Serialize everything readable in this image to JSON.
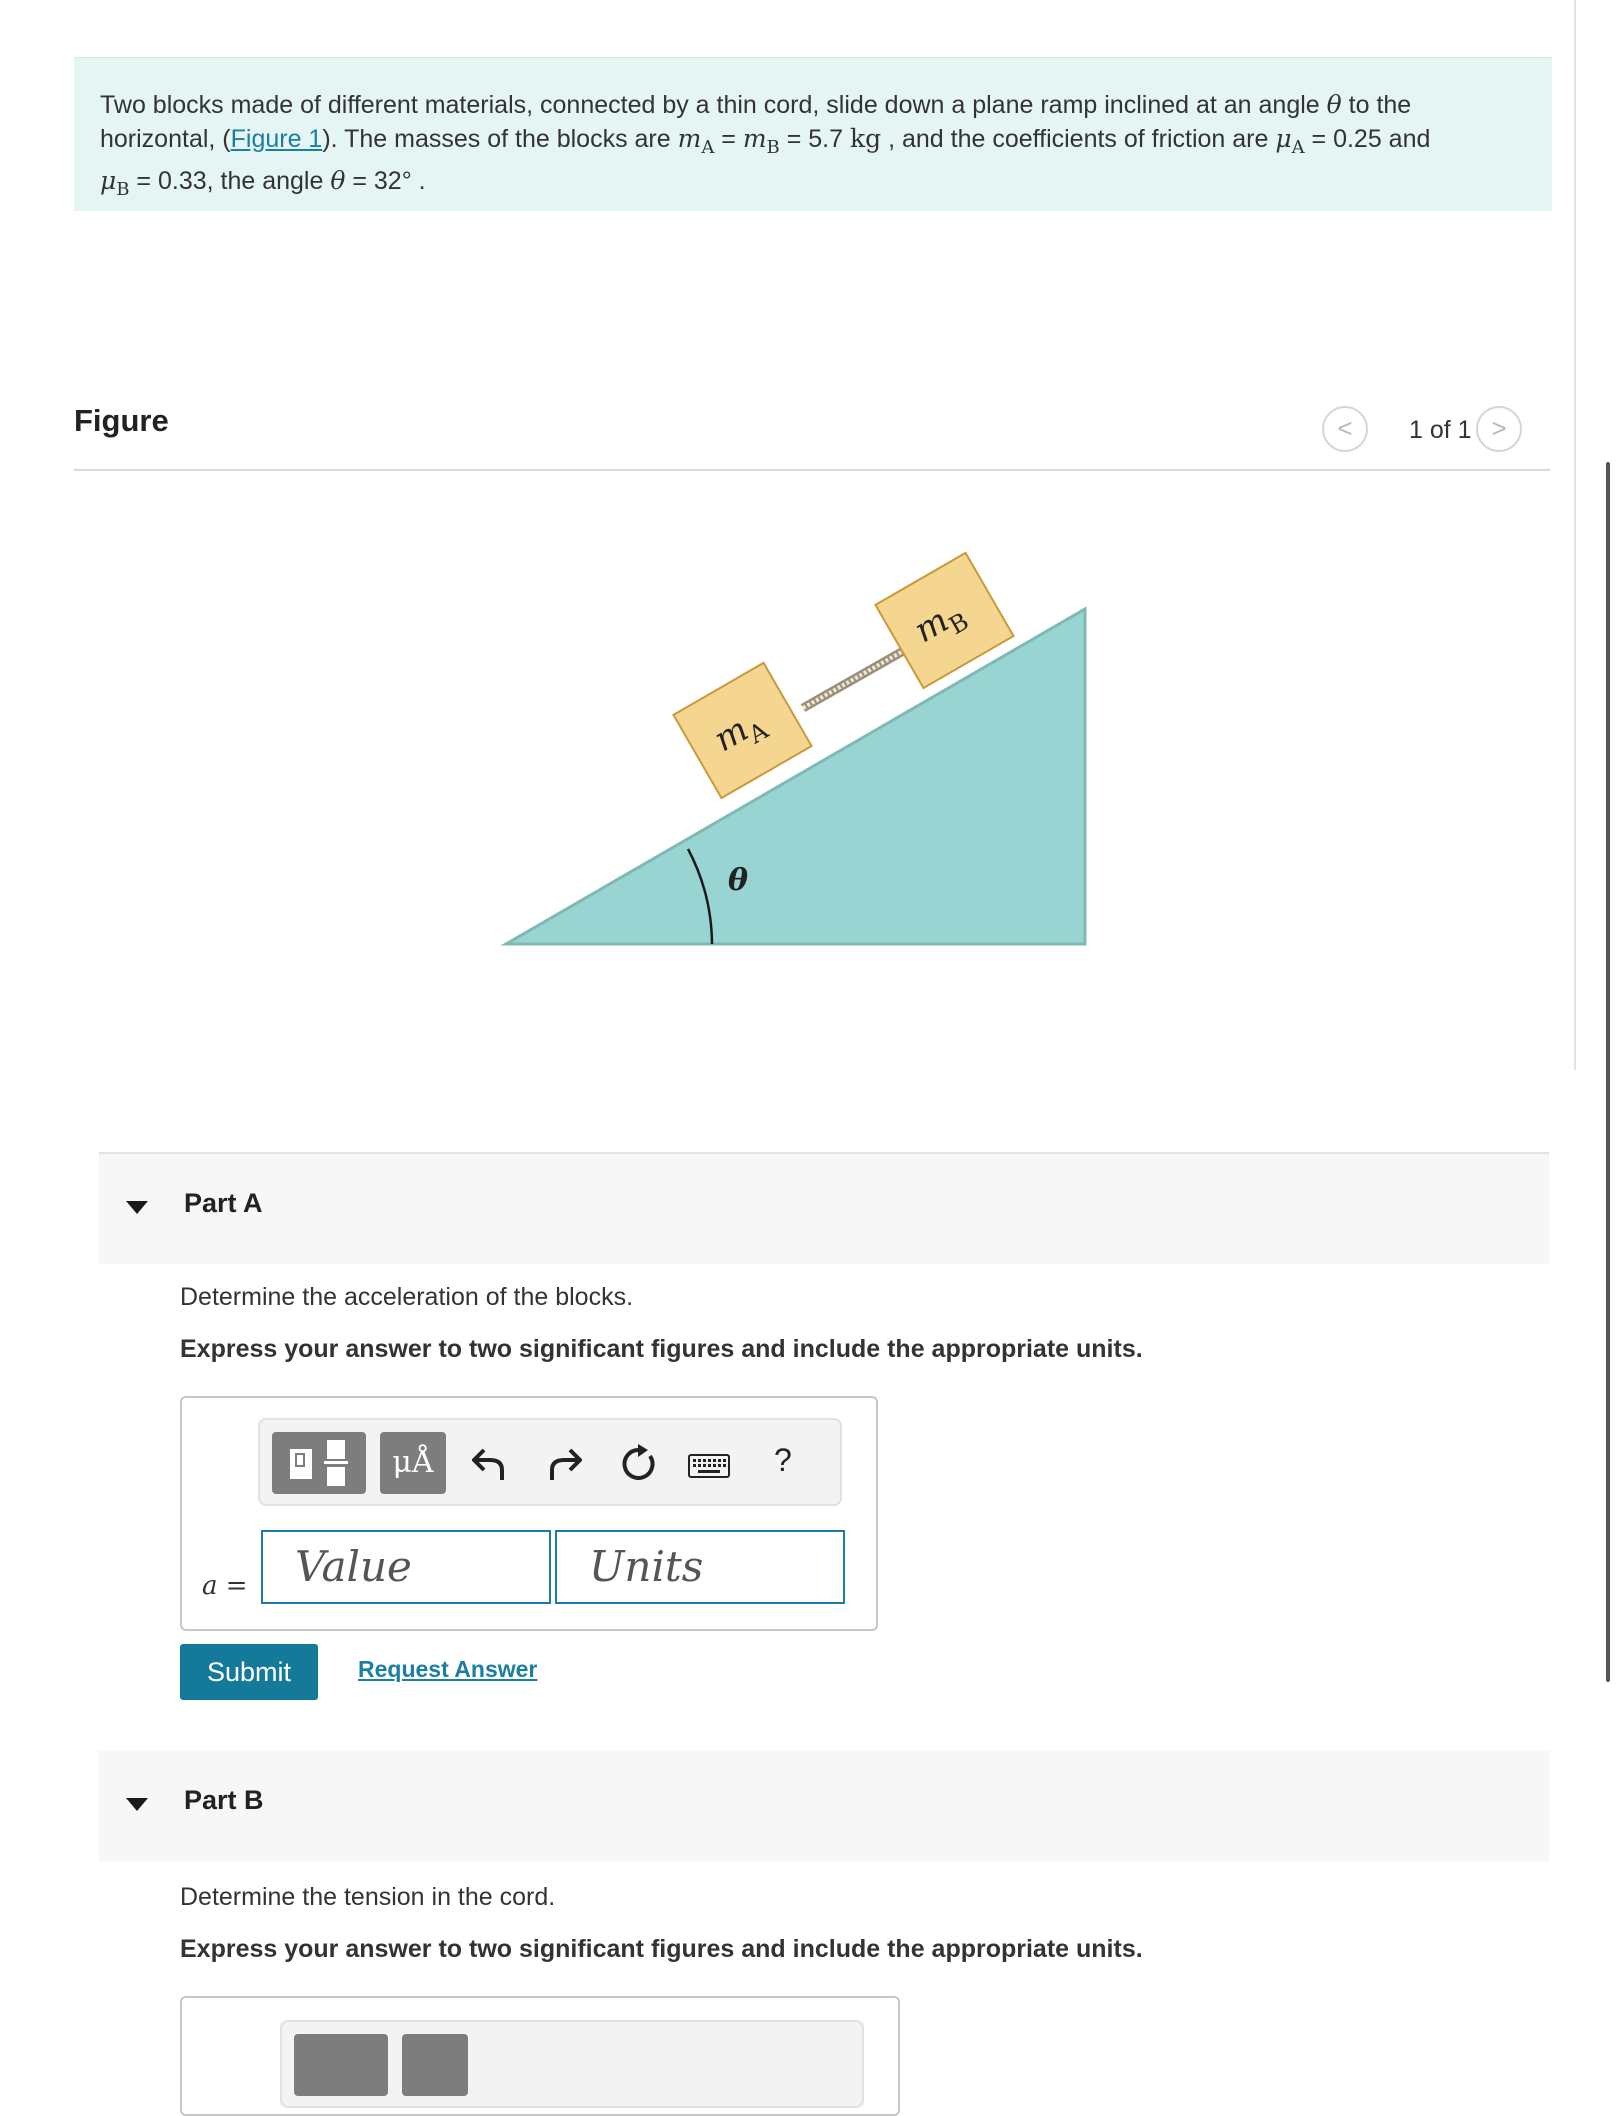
{
  "intro": {
    "t1": "Two blocks made of different materials, connected by a thin cord, slide down a plane ramp inclined at an angle ",
    "theta": "θ",
    "t2": " to the horizontal, (",
    "figure_link": "Figure 1",
    "t3": "). The masses of the blocks are ",
    "mA": "m",
    "mA_sub": "A",
    "eq1": " = ",
    "mB": "m",
    "mB_sub": "B",
    "mass_value": " = 5.7 ",
    "mass_unit": "kg",
    "t4": " , and the coefficients of friction are ",
    "muA": "μ",
    "muA_sub": "A",
    "muA_value": " = 0.25 and",
    "muB": "μ",
    "muB_sub": "B",
    "muB_value": " = 0.33, the angle ",
    "theta2": "θ",
    "angle_value": " = 32° ."
  },
  "figure": {
    "title": "Figure",
    "prev": "<",
    "next": ">",
    "page_count": "1 of 1",
    "label_mA": "m",
    "label_mA_sub": "A",
    "label_mB": "m",
    "label_mB_sub": "B",
    "label_theta": "θ",
    "colors": {
      "ramp": "#98d5d2",
      "block": "#f5d690",
      "block_edge": "#c89a3a"
    }
  },
  "partA": {
    "title": "Part A",
    "question": "Determine the acceleration of the blocks.",
    "instruction": "Express your answer to two significant figures and include the appropriate units.",
    "var_label": "a =",
    "value_placeholder": "Value",
    "units_placeholder": "Units",
    "toolbar_mu": "μÅ",
    "help": "?",
    "submit": "Submit",
    "request": "Request Answer"
  },
  "partB": {
    "title": "Part B",
    "question": "Determine the tension in the cord.",
    "instruction": "Express your answer to two significant figures and include the appropriate units."
  }
}
